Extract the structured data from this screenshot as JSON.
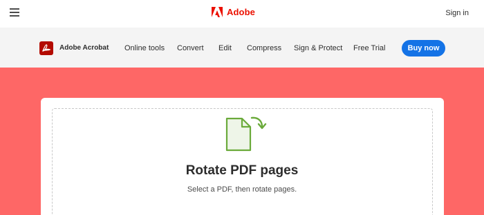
{
  "header": {
    "menu_icon": "hamburger-icon",
    "brand_name": "Adobe",
    "brand_icon": "adobe-logo-icon",
    "signin_label": "Sign in"
  },
  "nav": {
    "product_icon": "acrobat-logo-icon",
    "product_name": "Adobe Acrobat",
    "items": [
      {
        "label": "Online tools"
      },
      {
        "label": "Convert"
      },
      {
        "label": "Edit"
      },
      {
        "label": "Compress"
      },
      {
        "label": "Sign & Protect"
      },
      {
        "label": "Free Trial"
      }
    ],
    "cta_label": "Buy now"
  },
  "main": {
    "tool_icon": "rotate-pdf-icon",
    "title": "Rotate PDF pages",
    "subtitle": "Select a PDF, then rotate pages."
  },
  "colors": {
    "brand_red": "#eb1000",
    "acrobat_red": "#b30b00",
    "hero_background": "#fe6766",
    "cta_blue": "#1473e6",
    "icon_green": "#6aaa3a"
  }
}
